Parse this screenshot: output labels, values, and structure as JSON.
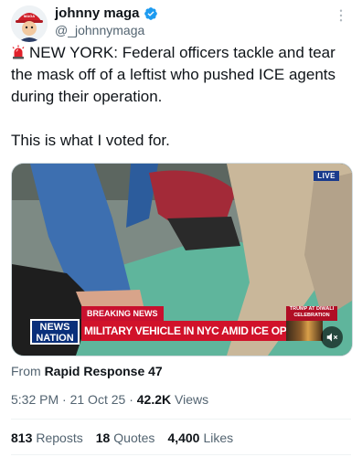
{
  "author": {
    "name": "johnny maga",
    "handle": "@_johnnymaga",
    "avatar_icon": "maga-hat-avatar-icon",
    "verified_icon": "verified-badge-icon",
    "verified_color": "#1d9bf0"
  },
  "tweet": {
    "emoji_icon": "police-siren-icon",
    "text_line1": "NEW YORK: Federal officers tackle and tear the mask off of a leftist who pushed ICE agents during their operation.",
    "text_line2": "This is what I voted for."
  },
  "media": {
    "live_badge": "LIVE",
    "breaking_label": "BREAKING NEWS",
    "headline": "MILITARY VEHICLE IN NYC AMID ICE OPERATION",
    "logo_top": "NEWS",
    "logo_bottom": "NATION",
    "side_label": "TRUMP AT DIWALI CELEBRATION",
    "mute_icon": "muted-speaker-icon"
  },
  "source": {
    "prefix": "From",
    "name": "Rapid Response 47"
  },
  "meta": {
    "time": "5:32 PM",
    "date": "21 Oct 25",
    "views_count": "42.2K",
    "views_label": "Views"
  },
  "stats": {
    "reposts_count": "813",
    "reposts_label": "Reposts",
    "quotes_count": "18",
    "quotes_label": "Quotes",
    "likes_count": "4,400",
    "likes_label": "Likes"
  },
  "colors": {
    "text_primary": "#0f1419",
    "text_secondary": "#536471",
    "chyron_red": "#d1122a",
    "news_nation_blue": "#0a2f7a"
  }
}
